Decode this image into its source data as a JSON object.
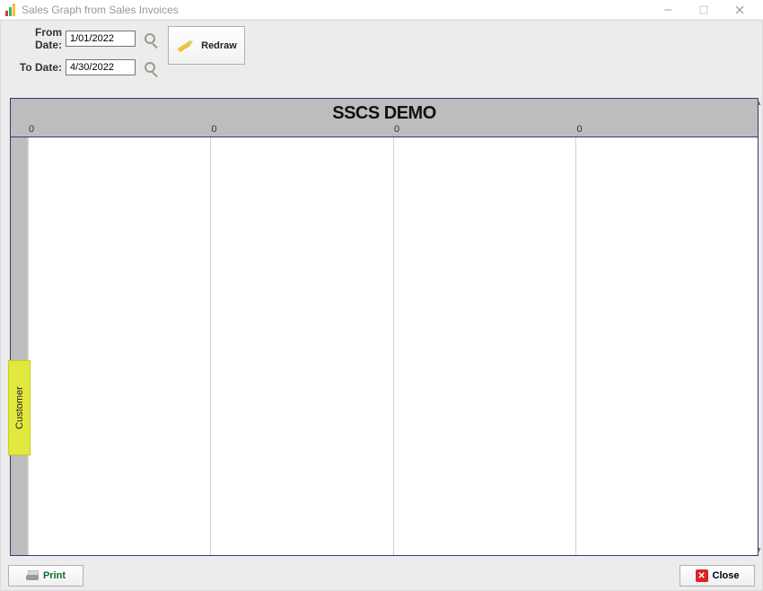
{
  "window": {
    "title": "Sales Graph from Sales Invoices"
  },
  "fields": {
    "from_label": "From Date:",
    "from_value": "1/01/2022",
    "to_label": "To Date:",
    "to_value": "4/30/2022"
  },
  "actions": {
    "redraw": "Redraw",
    "print": "Print",
    "close": "Close"
  },
  "side_tab": {
    "label": "Customer"
  },
  "chart_data": {
    "type": "bar",
    "title": "SSCS DEMO",
    "categories": [
      "0",
      "0",
      "0",
      "0"
    ],
    "values": [
      0,
      0,
      0,
      0
    ],
    "xlabel": "",
    "ylabel": "",
    "ylim": [
      0,
      0
    ]
  }
}
